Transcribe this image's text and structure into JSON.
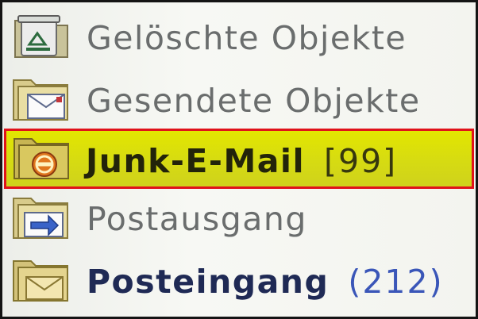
{
  "folders": [
    {
      "label": "Gelöschte Objekte",
      "icon": "trash-folder-icon",
      "count": "",
      "selected": false
    },
    {
      "label": "Gesendete Objekte",
      "icon": "sent-items-folder-icon",
      "count": "",
      "selected": false
    },
    {
      "label": "Junk-E-Mail",
      "icon": "junk-mail-folder-icon",
      "count": "[99]",
      "selected": true
    },
    {
      "label": "Postausgang",
      "icon": "outbox-folder-icon",
      "count": "",
      "selected": false
    },
    {
      "label": "Posteingang",
      "icon": "inbox-folder-icon",
      "count": "(212)",
      "selected": false
    }
  ],
  "colors": {
    "selection_fill": "#d6db12",
    "selection_border": "#e0121a",
    "unread_count": "#3a56b8",
    "bold_label": "#1f2a55"
  }
}
